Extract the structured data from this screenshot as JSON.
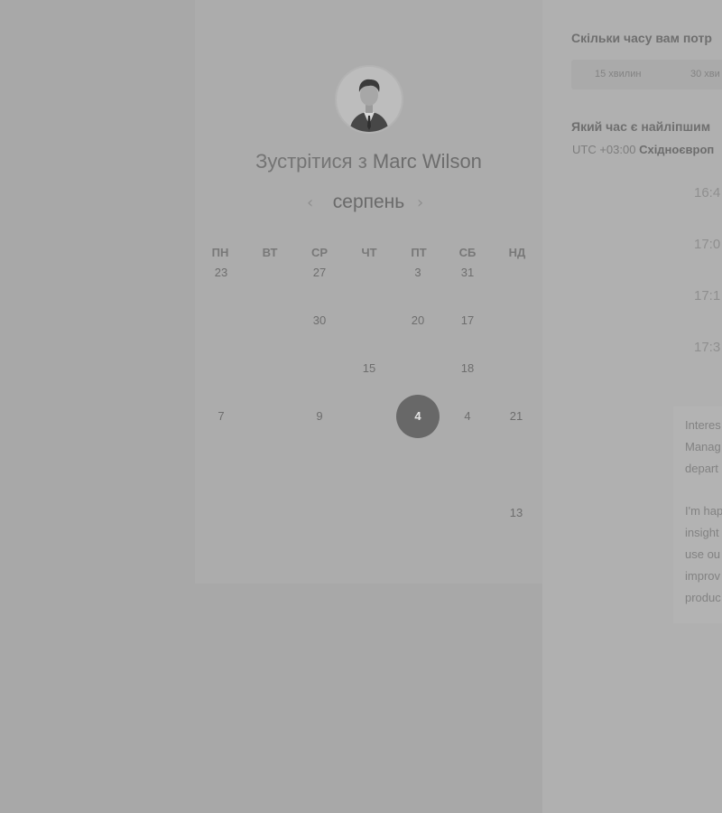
{
  "booking": {
    "host": {
      "title_prefix": "Зустрітися з",
      "name": "Marc Wilson",
      "avatar": "user-portrait-icon"
    },
    "calendar": {
      "month": "серпень",
      "prev_icon": "chevron-left-icon",
      "next_icon": "chevron-right-icon",
      "weekdays": [
        "ПН",
        "ВТ",
        "СР",
        "ЧТ",
        "ПТ",
        "СБ",
        "НД"
      ],
      "weeks": [
        [
          "23",
          "",
          "27",
          "",
          "3",
          "31",
          ""
        ],
        [
          "",
          "",
          "30",
          "",
          "20",
          "17",
          ""
        ],
        [
          "",
          "",
          "",
          "15",
          "",
          "18",
          ""
        ],
        [
          "7",
          "",
          "9",
          "",
          "4",
          "4",
          "21"
        ],
        [
          "",
          "",
          "",
          "",
          "",
          "",
          ""
        ],
        [
          "",
          "",
          "",
          "",
          "",
          "",
          "13"
        ]
      ],
      "selected": {
        "week": 3,
        "day": 4
      }
    },
    "duration": {
      "question": "Скільки часу вам потр",
      "options": [
        "15 хвилин",
        "30 хви"
      ]
    },
    "time": {
      "question": "Який час є найліпшим",
      "timezone_offset": "UTC +03:00",
      "timezone_name": "Східноєвроп",
      "slots": [
        "16:4",
        "17:0",
        "17:1",
        "17:3"
      ]
    },
    "description": {
      "lines": [
        "Interes",
        "Manag",
        "depart",
        "",
        "I'm hap",
        "insight",
        "use ou",
        "improv",
        "produc"
      ]
    }
  }
}
